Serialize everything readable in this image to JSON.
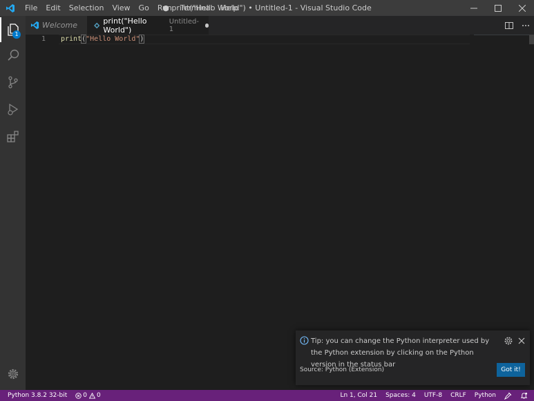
{
  "titlebar": {
    "menu": [
      "File",
      "Edit",
      "Selection",
      "View",
      "Go",
      "Run",
      "Terminal",
      "Help"
    ],
    "window_title": "● print(\"Hello World\") • Untitled-1 - Visual Studio Code"
  },
  "activity_bar": {
    "explorer_badge": "1"
  },
  "tabs": {
    "welcome_label": "Welcome",
    "active_label": "print(\"Hello World\")",
    "active_description": "Untitled-1"
  },
  "editor": {
    "line_number": "1",
    "code": {
      "function": "print",
      "open_paren": "(",
      "string": "\"Hello World\"",
      "close_paren": ")"
    }
  },
  "notification": {
    "message": "Tip: you can change the Python interpreter used by the Python extension by clicking on the Python version in the status bar",
    "source": "Source: Python (Extension)",
    "button_label": "Got it!"
  },
  "statusbar": {
    "interpreter": "Python 3.8.2 32-bit",
    "errors": "0",
    "warnings": "0",
    "cursor_position": "Ln 1, Col 21",
    "indentation": "Spaces: 4",
    "encoding": "UTF-8",
    "eol": "CRLF",
    "language": "Python"
  },
  "colors": {
    "statusbar_bg": "#68217a",
    "accent": "#007acc",
    "button_bg": "#0e639c"
  }
}
